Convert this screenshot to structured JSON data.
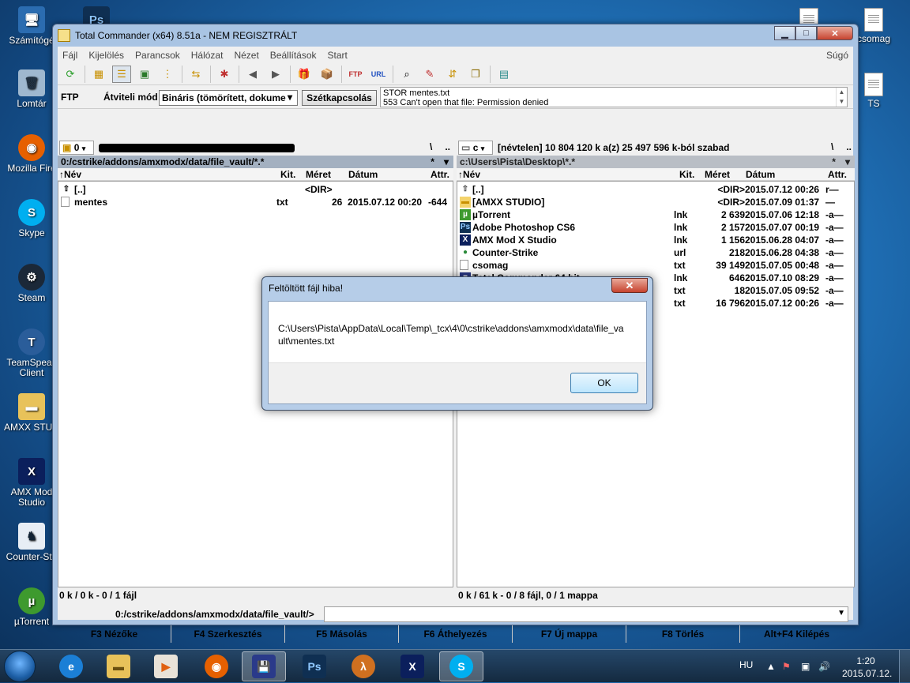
{
  "desktop": {
    "icons_left": [
      {
        "label": "Számítógé"
      },
      {
        "label": "Lomtár"
      },
      {
        "label": "Mozilla Fire"
      },
      {
        "label": "Skype"
      },
      {
        "label": "Steam"
      },
      {
        "label": "TeamSpeak Client"
      },
      {
        "label": "AMXX STUD"
      },
      {
        "label": "AMX Mod Studio"
      },
      {
        "label": "Counter-Stri"
      },
      {
        "label": "µTorrent"
      }
    ],
    "icons_right": [
      {
        "label": "csomag"
      },
      {
        "label": "TS"
      }
    ]
  },
  "window": {
    "title": "Total Commander (x64) 8.51a - NEM REGISZTRÁLT",
    "min": "▁",
    "max": "□",
    "close": "✕"
  },
  "menu": [
    "Fájl",
    "Kijelölés",
    "Parancsok",
    "Hálózat",
    "Nézet",
    "Beállítások",
    "Start"
  ],
  "menu_help": "Súgó",
  "ftp": {
    "label": "FTP",
    "mode_label": "Átviteli mód",
    "mode_value": "Bináris (tömörített, dokume",
    "disconnect": "Szétkapcsolás",
    "log_line1": "STOR mentes.txt",
    "log_line2": "553 Can't open that file: Permission denied"
  },
  "left_panel": {
    "drive": "0",
    "path": "0:/cstrike/addons/amxmodx/data/file_vault/*.*",
    "headers": {
      "name": "Név",
      "ext": "Kit.",
      "size": "Méret",
      "date": "Dátum",
      "attr": "Attr."
    },
    "files": [
      {
        "name": "[..]",
        "ext": "",
        "size": "<DIR>",
        "date": "",
        "attr": ""
      },
      {
        "name": "mentes",
        "ext": "txt",
        "size": "26",
        "date": "2015.07.12 00:20",
        "attr": "-644"
      }
    ],
    "status": "0 k / 0 k - 0 / 1 fájl"
  },
  "right_panel": {
    "drive": "c",
    "drive_info": "[névtelen]  10 804 120 k a(z) 25 497 596 k-ból szabad",
    "path": "c:\\Users\\Pista\\Desktop\\*.*",
    "headers": {
      "name": "Név",
      "ext": "Kit.",
      "size": "Méret",
      "date": "Dátum",
      "attr": "Attr."
    },
    "files": [
      {
        "name": "[..]",
        "ext": "",
        "size": "<DIR>",
        "date": "2015.07.12 00:26",
        "attr": "r—",
        "icon": "up-icon"
      },
      {
        "name": "[AMXX STUDIO]",
        "ext": "",
        "size": "<DIR>",
        "date": "2015.07.09 01:37",
        "attr": "—",
        "icon": "folder-icon"
      },
      {
        "name": "µTorrent",
        "ext": "lnk",
        "size": "2 639",
        "date": "2015.07.06 12:18",
        "attr": "-a—",
        "icon": "utorrent-icon"
      },
      {
        "name": "Adobe Photoshop CS6",
        "ext": "lnk",
        "size": "2 157",
        "date": "2015.07.07 00:19",
        "attr": "-a—",
        "icon": "photoshop-icon"
      },
      {
        "name": "AMX Mod X Studio",
        "ext": "lnk",
        "size": "1 156",
        "date": "2015.06.28 04:07",
        "attr": "-a—",
        "icon": "amx-icon"
      },
      {
        "name": "Counter-Strike",
        "ext": "url",
        "size": "218",
        "date": "2015.06.28 04:38",
        "attr": "-a—",
        "icon": "globe-icon"
      },
      {
        "name": "csomag",
        "ext": "txt",
        "size": "39 149",
        "date": "2015.07.05 00:48",
        "attr": "-a—",
        "icon": "text-file-icon"
      },
      {
        "name": "Total Commander 64 bit",
        "ext": "lnk",
        "size": "646",
        "date": "2015.07.10 08:29",
        "attr": "-a—",
        "icon": "floppy-icon"
      },
      {
        "name": "TS",
        "ext": "txt",
        "size": "18",
        "date": "2015.07.05 09:52",
        "attr": "-a—",
        "icon": "text-file-icon"
      },
      {
        "name": "",
        "ext": "txt",
        "size": "16 796",
        "date": "2015.07.12 00:26",
        "attr": "-a—",
        "icon": "text-file-icon"
      }
    ],
    "status": "0 k / 61 k - 0 / 8 fájl, 0 / 1 mappa"
  },
  "cmdline": {
    "path": "0:/cstrike/addons/amxmodx/data/file_vault/>"
  },
  "fkeys": [
    "F3 Nézőke",
    "F4 Szerkesztés",
    "F5 Másolás",
    "F6 Áthelyezés",
    "F7 Új mappa",
    "F8 Törlés",
    "Alt+F4 Kilépés"
  ],
  "dialog": {
    "title": "Feltöltött fájl hiba!",
    "message": "C:\\Users\\Pista\\AppData\\Local\\Temp\\_tcx\\4\\0\\cstrike\\addons\\amxmodx\\data\\file_vault\\mentes.txt",
    "ok": "OK"
  },
  "taskbar": {
    "lang": "HU",
    "time": "1:20",
    "date": "2015.07.12."
  }
}
